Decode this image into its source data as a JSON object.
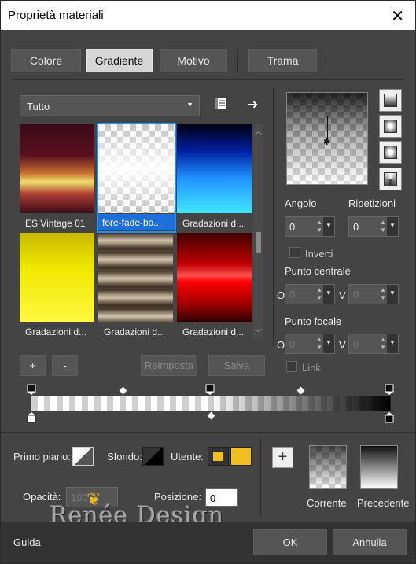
{
  "window": {
    "title": "Proprietà materiali",
    "close_glyph": "✕"
  },
  "tabs": [
    {
      "label": "Colore",
      "active": false
    },
    {
      "label": "Gradiente",
      "active": true
    },
    {
      "label": "Motivo",
      "active": false
    },
    {
      "label": "Trama",
      "active": false
    }
  ],
  "library": {
    "category": "Tutto",
    "items": [
      {
        "label": "ES Vintage 01"
      },
      {
        "label": "fore-fade-ba..."
      },
      {
        "label": "Gradazioni d..."
      },
      {
        "label": "Gradazioni d..."
      },
      {
        "label": "Gradazioni d..."
      },
      {
        "label": "Gradazioni d..."
      }
    ],
    "add_label": "+",
    "remove_label": "-",
    "reset_label": "Reimposta",
    "save_label": "Salva"
  },
  "settings": {
    "angle_label": "Angolo",
    "angle_value": "0",
    "repeat_label": "Ripetizioni",
    "repeat_value": "0",
    "invert_label": "Inverti",
    "center_label": "Punto centrale",
    "center_o_label": "O",
    "center_o_value": "0",
    "center_v_label": "V",
    "center_v_value": "0",
    "focal_label": "Punto focale",
    "focal_o_label": "O",
    "focal_o_value": "0",
    "focal_v_label": "V",
    "focal_v_value": "0",
    "link_label": "Link"
  },
  "bottom": {
    "foreground_label": "Primo piano:",
    "background_label": "Sfondo:",
    "user_label": "Utente:",
    "user_color": "#f0c020",
    "opacity_label": "Opacità:",
    "opacity_value": "100",
    "position_label": "Posizione:",
    "position_value": "0",
    "add_glyph": "+",
    "current_label": "Corrente",
    "previous_label": "Precedente",
    "watermark": "Renée Design"
  },
  "footer": {
    "help_label": "Guida",
    "ok_label": "OK",
    "cancel_label": "Annulla"
  }
}
